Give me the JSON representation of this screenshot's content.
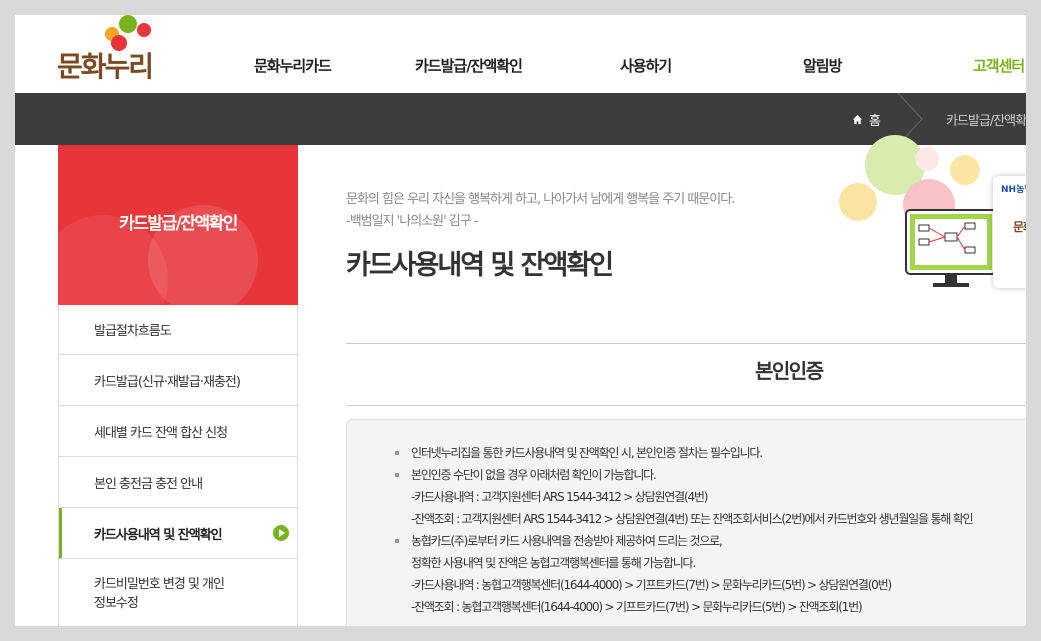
{
  "header": {
    "logo_text": "문화누리",
    "nav": [
      {
        "label": "문화누리카드"
      },
      {
        "label": "카드발급/잔액확인"
      },
      {
        "label": "사용하기"
      },
      {
        "label": "알림방"
      },
      {
        "label": "고객센터"
      }
    ]
  },
  "breadcrumb": {
    "home": "홈",
    "current": "카드발급/잔액확인"
  },
  "sidebar": {
    "title": "카드발급/잔액확인",
    "items": [
      {
        "label": "발급절차흐름도"
      },
      {
        "label": "카드발급(신규·재발급·재충전)"
      },
      {
        "label": "세대별 카드 잔액 합산 신청"
      },
      {
        "label": "본인 충전금 충전 안내"
      },
      {
        "label": "카드사용내역 및 잔액확인"
      },
      {
        "label": "카드비밀번호 변경 및 개인",
        "label2": "정보수정"
      }
    ]
  },
  "main": {
    "quote_line1": "문화의 힘은 우리 자신을 행복하게 하고, 나아가서 남에게 행복을 주기 때문이다.",
    "quote_line2": "-백범일지 '나의소원' 김구 -",
    "page_title": "카드사용내역 및 잔액확인",
    "section_title": "본인인증",
    "info": [
      "인터넷누리집을 통한 카드사용내역 및 잔액확인 시, 본인인증 절차는 필수입니다.",
      "본인인증 수단이 없을 경우 아래처럼 확인이 가능합니다.",
      "-카드사용내역 : 고객지원센터 ARS 1544-3412 > 상담원연결(4번)",
      "-잔액조회 : 고객지원센터 ARS 1544-3412 > 상담원연결(4번) 또는 잔액조회서비스(2번)에서 카드번호와 생년월일을 통해 확인",
      "농협카드(주)로부터 카드 사용내역을 전송받아 제공하여 드리는 것으로,",
      "정확한 사용내역 및 잔액은 농협고객행복센터를 통해 가능합니다.",
      "-카드사용내역 : 농협고객행복센터(1644-4000) > 기프트카드(7번) > 문화누리카드(5번) > 상담원연결(0번)",
      "-잔액조회 : 농협고객행복센터(1644-4000) > 기프트카드(7번) > 문화누리카드(5번) > 잔액조회(1번)"
    ]
  },
  "illustration": {
    "card_brand": "NH농협",
    "card_text": "문화누"
  },
  "colors": {
    "accent_green": "#7bb320",
    "sidebar_red": "#e8353a",
    "band_dark": "#3d3d3d"
  }
}
